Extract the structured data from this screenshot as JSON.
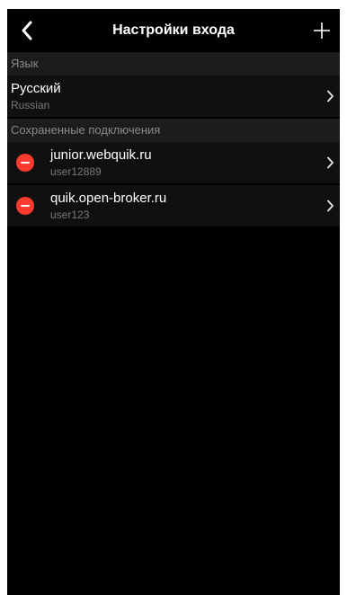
{
  "nav": {
    "title": "Настройки входа",
    "back_icon": "chevron-left-icon",
    "add_icon": "plus-icon"
  },
  "language_section": {
    "header": "Язык",
    "item": {
      "title": "Русский",
      "subtitle": "Russian"
    }
  },
  "connections_section": {
    "header": "Сохраненные подключения",
    "items": [
      {
        "title": "junior.webquik.ru",
        "subtitle": "user12889"
      },
      {
        "title": "quik.open-broker.ru",
        "subtitle": "user123"
      }
    ]
  },
  "colors": {
    "background": "#000000",
    "section_header_bg": "#1c1c1c",
    "row_bg": "#101010",
    "delete_red": "#ff3b30",
    "secondary_text": "#7a7a7a"
  }
}
